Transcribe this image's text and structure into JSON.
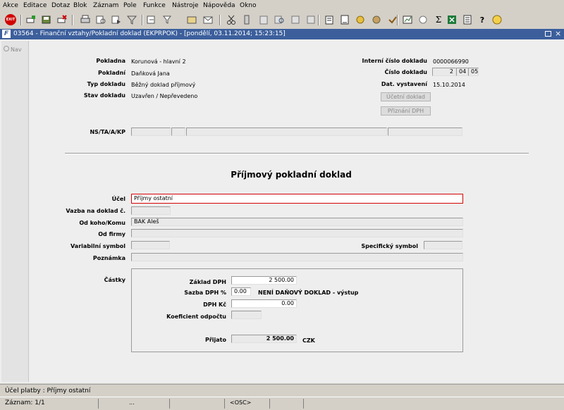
{
  "menu": [
    "Akce",
    "Editace",
    "Dotaz",
    "Blok",
    "Záznam",
    "Pole",
    "Funkce",
    "Nástroje",
    "Nápověda",
    "Okno"
  ],
  "toolbar": {
    "exit_label": "EXIT",
    "icons": [
      "exit-icon",
      "new-record-icon",
      "save-icon",
      "delete-record-icon",
      "print-icon",
      "query-icon",
      "execute-query-icon",
      "filter-icon",
      "prev-record-icon",
      "next-record-icon",
      "attach-icon",
      "mail-icon",
      "cut-icon",
      "copy-icon",
      "paste-icon",
      "find-icon",
      "calendar-icon",
      "edit-icon",
      "document-icon",
      "clock-icon",
      "help-wheel-icon",
      "cert-icon",
      "mark-icon",
      "chart-icon",
      "sum-icon",
      "excel-icon",
      "list-icon",
      "question-icon",
      "info-icon"
    ]
  },
  "window": {
    "title": "03564 - Finanční vztahy/Pokladní doklad (EKPRPOK) - [pondělí, 03.11.2014; 15:23:15]",
    "nav_label": "Nav"
  },
  "header": {
    "pokladna_label": "Pokladna",
    "pokladna_value": "Korunová - hlavní 2",
    "pokladni_label": "Pokladní",
    "pokladni_value": "Daňková Jana",
    "typ_label": "Typ dokladu",
    "typ_value": "Běžný doklad příjmový",
    "stav_label": "Stav dokladu",
    "stav_value": "Uzavřen / Nepřevedeno",
    "interni_label": "Interní číslo dokladu",
    "interni_value": "0000066990",
    "cislo_label": "Číslo dokladu",
    "cislo_1": "2",
    "cislo_2": "04",
    "cislo_3": "05",
    "dat_label": "Dat. vystavení",
    "dat_value": "15.10.2014",
    "ucetni_button": "Účetní doklad",
    "priznani_button": "Přiznání DPH",
    "ns_label": "NS/TA/A/KP"
  },
  "doc_title": "Příjmový pokladní doklad",
  "form": {
    "ucel_label": "Účel",
    "ucel_value": "Příjmy ostatní",
    "vazba_label": "Vazba na doklad č.",
    "odkoho_label": "Od koho/Komu",
    "odkoho_value": "BAK Aleš",
    "odfirmy_label": "Od firmy",
    "vs_label": "Variabilní symbol",
    "ss_label": "Specifický symbol",
    "poznamka_label": "Poznámka"
  },
  "castky": {
    "label": "Částky",
    "zaklad_label": "Základ DPH",
    "zaklad_value": "2 500.00",
    "sazba_label": "Sazba DPH %",
    "sazba_value": "0.00",
    "sazba_note": "NENÍ DAŇOVÝ DOKLAD - výstup",
    "dph_label": "DPH Kč",
    "dph_value": "0.00",
    "koef_label": "Koeficient odpočtu",
    "prijato_label": "Přijato",
    "prijato_value": "2 500.00",
    "currency": "CZK"
  },
  "status": {
    "line1": "Účel platby : Příjmy ostatní",
    "record": "Záznam: 1/1",
    "ellipsis": "...",
    "mode": "<OSC>"
  }
}
